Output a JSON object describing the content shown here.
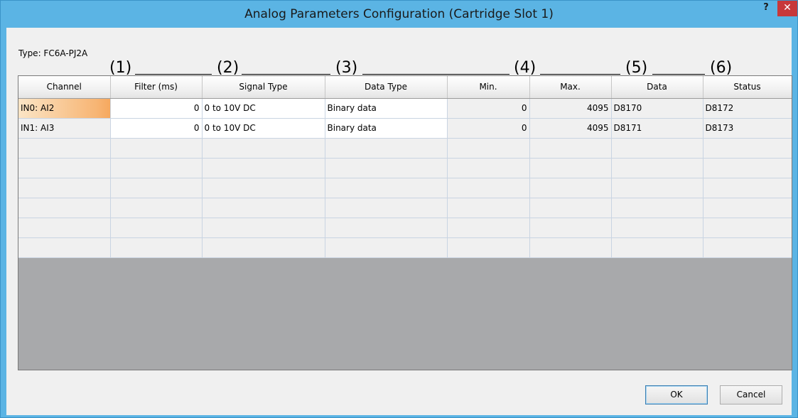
{
  "window": {
    "title": "Analog Parameters Configuration (Cartridge Slot 1)",
    "help_label": "?",
    "close_label": "✕"
  },
  "type_label": "Type: FC6A-PJ2A",
  "callouts": [
    "(1)",
    "(2)",
    "(3)",
    "(4)",
    "(5)",
    "(6)"
  ],
  "table": {
    "columns": [
      "Channel",
      "Filter (ms)",
      "Signal Type",
      "Data Type",
      "Min.",
      "Max.",
      "Data",
      "Status"
    ],
    "rows": [
      [
        "IN0: AI2",
        "0",
        "0 to 10V DC",
        "Binary data",
        "0",
        "4095",
        "D8170",
        "D8172"
      ],
      [
        "IN1: AI3",
        "0",
        "0 to 10V DC",
        "Binary data",
        "0",
        "4095",
        "D8171",
        "D8173"
      ]
    ],
    "empty_rows": 6
  },
  "buttons": {
    "ok": "OK",
    "cancel": "Cancel"
  },
  "colors": {
    "titlebar": "#5bb4e4",
    "close": "#c7383a",
    "selected_cell": "#f7b574",
    "grid_background": "#a8a9ab"
  }
}
